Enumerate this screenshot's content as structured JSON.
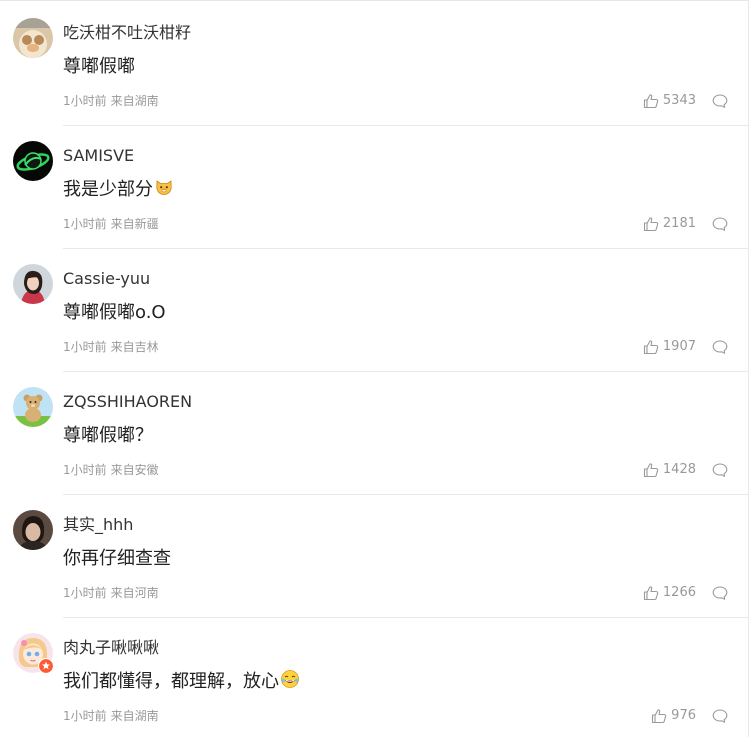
{
  "comments": [
    {
      "username": "吃沃柑不吐沃柑籽",
      "content": "尊嘟假嘟",
      "emoji": "",
      "time": "1小时前",
      "location": "来自湖南",
      "likes": "5343",
      "avatar_icon": "pet-photo-icon"
    },
    {
      "username": "SAMISVE",
      "content": "我是少部分",
      "emoji": "cat-face-emoji",
      "time": "1小时前",
      "location": "来自新疆",
      "likes": "2181",
      "avatar_icon": "planet-ring-icon"
    },
    {
      "username": "Cassie-yuu",
      "content": "尊嘟假嘟o.O",
      "emoji": "",
      "time": "1小时前",
      "location": "来自吉林",
      "likes": "1907",
      "avatar_icon": "girl-portrait-icon"
    },
    {
      "username": "ZQSSHIHAOREN",
      "content": "尊嘟假嘟？",
      "emoji": "",
      "time": "1小时前",
      "location": "来自安徽",
      "likes": "1428",
      "avatar_icon": "cartoon-bear-icon"
    },
    {
      "username": "其实_hhh",
      "content": "你再仔细查查",
      "emoji": "",
      "time": "1小时前",
      "location": "来自河南",
      "likes": "1266",
      "avatar_icon": "person-photo-icon"
    },
    {
      "username": "肉丸子啾啾啾",
      "content": "我们都懂得，都理解，放心",
      "emoji": "laughing-emoji",
      "time": "1小时前",
      "location": "来自湖南",
      "likes": "976",
      "avatar_icon": "anime-girl-icon"
    }
  ],
  "icons": {
    "like": "thumb-up-icon",
    "reply": "comment-bubble-icon"
  },
  "colors": {
    "meta_text": "#999999",
    "divider": "#e9e9e9",
    "username": "#333333",
    "content": "#222222",
    "verified_badge": "#ff5a36"
  }
}
